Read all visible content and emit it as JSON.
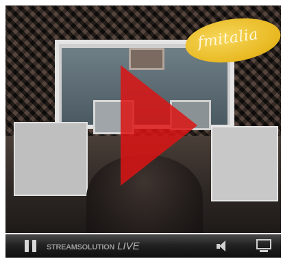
{
  "video": {
    "station_logo": "fmitalia",
    "play_icon": "play-triangle-icon",
    "play_color": "#dc1414"
  },
  "controls": {
    "pause_icon": "pause-icon",
    "brand_label": "STREAMSOLUTION",
    "live_label": "LIVE",
    "volume_icon": "speaker-icon",
    "fullscreen_icon": "monitor-fullscreen-icon",
    "bar_color": "#1a1a1a"
  }
}
